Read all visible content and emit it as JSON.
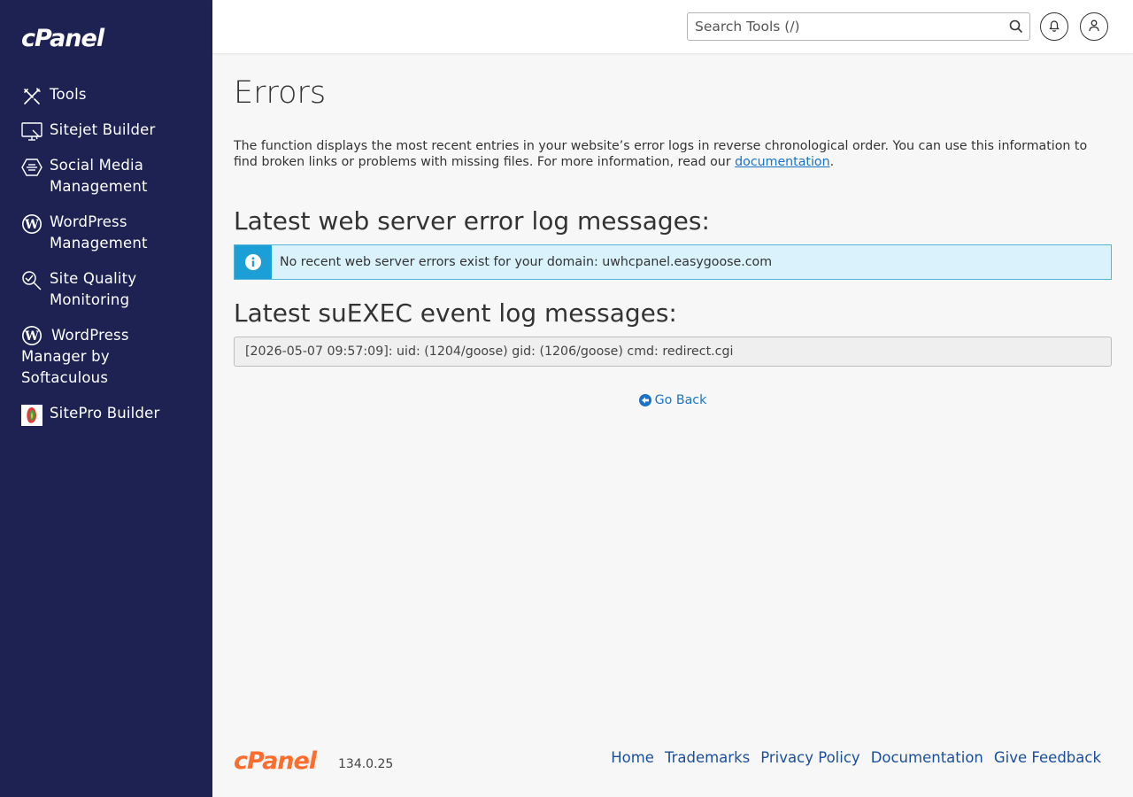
{
  "brand": {
    "logo": "cPanel"
  },
  "sidebar": {
    "items": [
      {
        "label": "Tools",
        "icon": "tools-icon"
      },
      {
        "label": "Sitejet Builder",
        "icon": "sitejet-icon"
      },
      {
        "label": "Social Media Management",
        "icon": "social-media-icon"
      },
      {
        "label": "WordPress Management",
        "icon": "wordpress-icon"
      },
      {
        "label": "Site Quality Monitoring",
        "icon": "site-quality-icon"
      },
      {
        "label": "WordPress Manager by Softaculous",
        "icon": "wordpress-icon"
      },
      {
        "label": "SitePro Builder",
        "icon": "sitepro-icon"
      }
    ]
  },
  "header": {
    "search_placeholder": "Search Tools (/)",
    "icons": [
      "search-icon",
      "bell-icon",
      "user-icon"
    ]
  },
  "main": {
    "title": "Errors",
    "intro_text": "The function displays the most recent entries in your website’s error logs in reverse chronological order. You can use this information to find broken links or problems with missing files. For more information, read our ",
    "intro_link": "documentation",
    "intro_end": ".",
    "section1_title": "Latest web server error log messages:",
    "alert_text": "No recent web server errors exist for your domain: uwhcpanel.easygoose.com",
    "section2_title": "Latest suEXEC event log messages:",
    "log_text": "[2026-05-07 09:57:09]: uid: (1204/goose) gid: (1206/goose) cmd: redirect.cgi",
    "go_back": "Go Back"
  },
  "footer": {
    "logo": "cPanel",
    "version": "134.0.25",
    "links": [
      "Home",
      "Trademarks",
      "Privacy Policy",
      "Documentation",
      "Give Feedback"
    ]
  },
  "colors": {
    "sidebar_bg": "#1d2252",
    "link": "#1a73c8",
    "alert_bg": "#d9f2fb",
    "alert_icon_bg": "#1b9fd6",
    "footer_logo": "#ff6c2c"
  }
}
